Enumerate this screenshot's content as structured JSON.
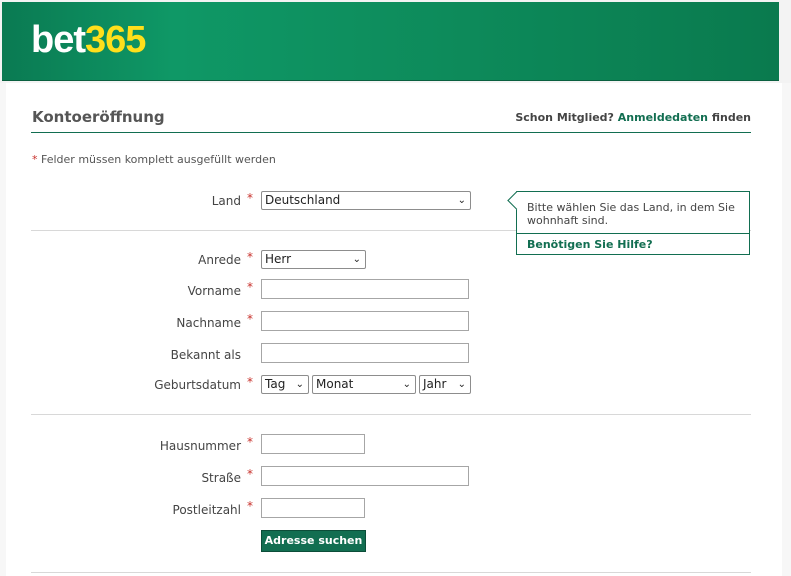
{
  "brand": {
    "logo_part1": "bet",
    "logo_part2": "365"
  },
  "header": {
    "title": "Kontoeröffnung",
    "member_text": "Schon Mitglied?",
    "member_link": "Anmeldedaten",
    "member_suffix": "finden"
  },
  "required_note": {
    "star": "*",
    "text": "Felder müssen komplett ausgefüllt werden"
  },
  "form": {
    "land": {
      "label": "Land",
      "value": "Deutschland"
    },
    "anrede": {
      "label": "Anrede",
      "value": "Herr"
    },
    "vorname": {
      "label": "Vorname",
      "value": ""
    },
    "nachname": {
      "label": "Nachname",
      "value": ""
    },
    "bekannt_als": {
      "label": "Bekannt als",
      "value": ""
    },
    "geburtsdatum": {
      "label": "Geburtsdatum",
      "day": "Tag",
      "month": "Monat",
      "year": "Jahr"
    },
    "hausnummer": {
      "label": "Hausnummer",
      "value": ""
    },
    "strasse": {
      "label": "Straße",
      "value": ""
    },
    "postleitzahl": {
      "label": "Postleitzahl",
      "value": ""
    },
    "search_button": "Adresse suchen"
  },
  "tooltip": {
    "text": "Bitte wählen Sie das Land, in dem Sie wohnhaft sind.",
    "help": "Benötigen Sie Hilfe?"
  },
  "required_marker": "*",
  "colors": {
    "brand_green": "#126e51",
    "logo_yellow": "#ffdf1b",
    "required_red": "#c8312b"
  }
}
